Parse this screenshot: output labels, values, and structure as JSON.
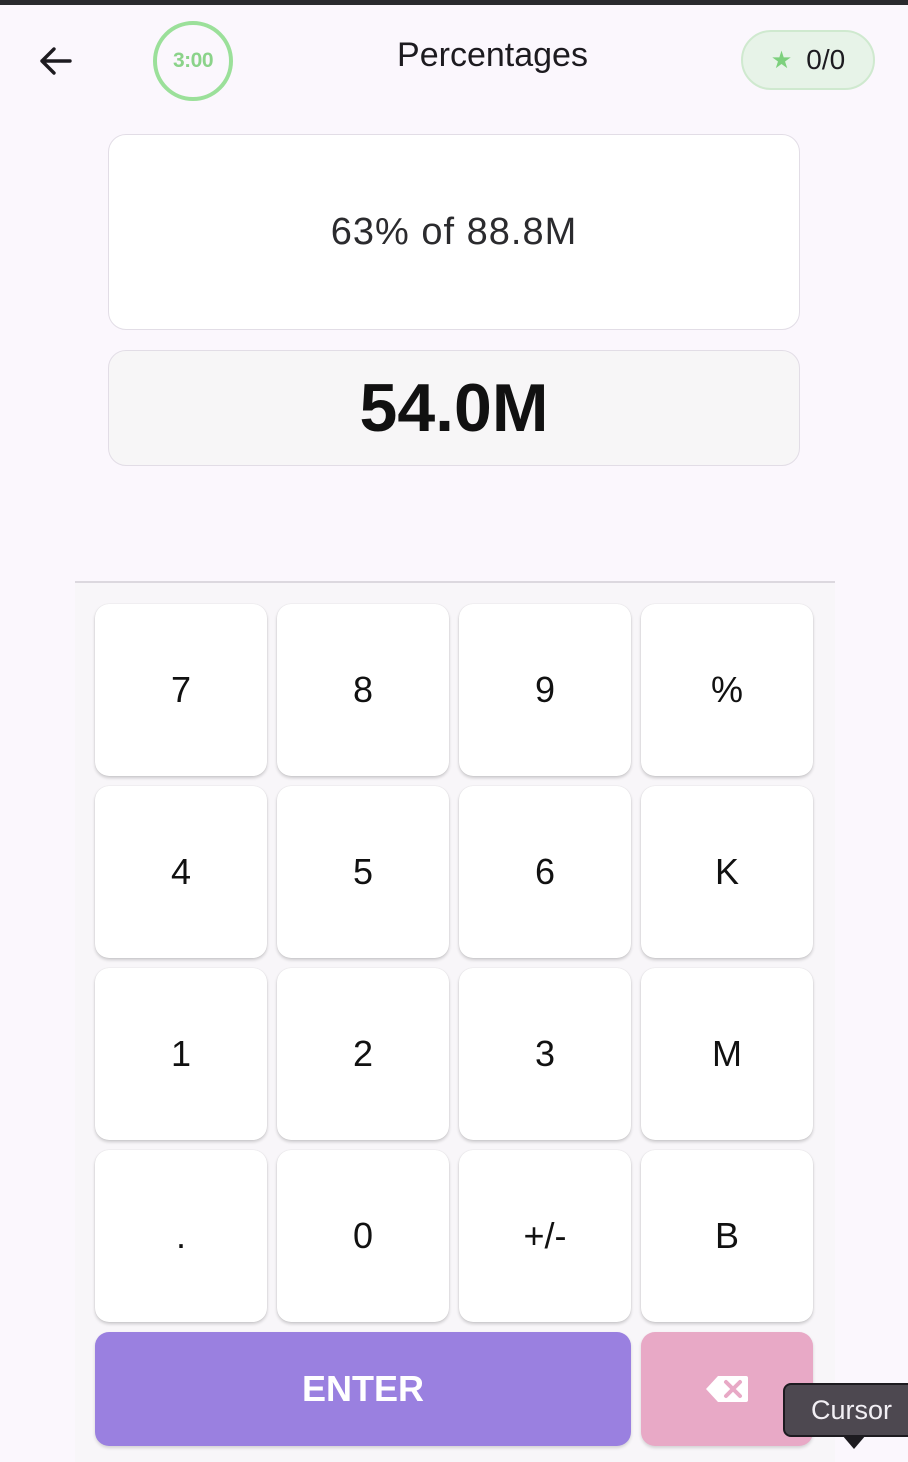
{
  "header": {
    "back_icon": "arrow-left-icon",
    "timer": "3:00",
    "title": "Percentages",
    "score": "0/0",
    "score_icon": "star-icon",
    "timer_color": "#9be09a"
  },
  "question": {
    "text": "63% of 88.8M"
  },
  "answer": {
    "text": "54.0M"
  },
  "keypad": {
    "keys": [
      "7",
      "8",
      "9",
      "%",
      "4",
      "5",
      "6",
      "K",
      "1",
      "2",
      "3",
      "M",
      ".",
      "0",
      "+/-",
      "B"
    ],
    "enter_label": "ENTER",
    "backspace_icon": "backspace-icon",
    "enter_color": "#9a80e0",
    "backspace_color": "#e8a9c6"
  },
  "tooltip": {
    "label": "Cursor"
  }
}
